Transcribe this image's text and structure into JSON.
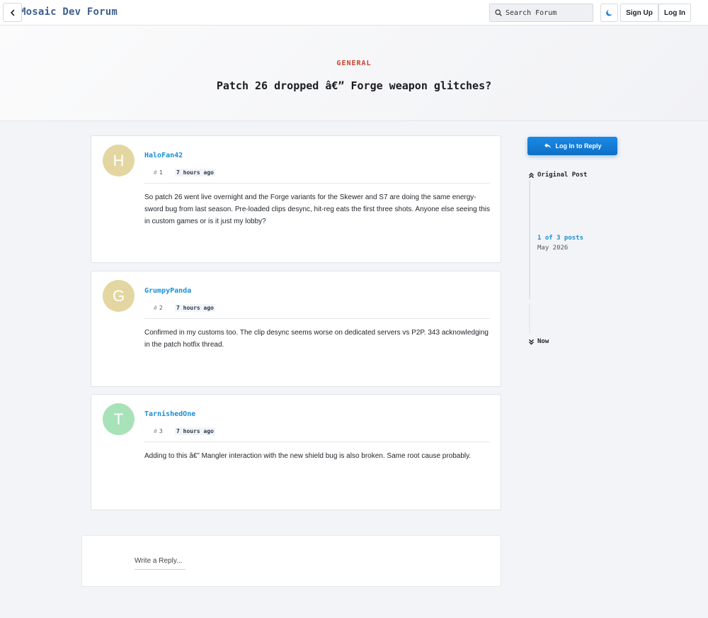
{
  "header": {
    "brand": "Mosaic Dev Forum",
    "search_placeholder": "Search Forum",
    "signup_label": "Sign Up",
    "login_label": "Log In"
  },
  "topic": {
    "category": "GENERAL",
    "title": "Patch 26 dropped â€” Forge weapon glitches?"
  },
  "posts": [
    {
      "initial": "H",
      "avatar_color": "#e3d6a0",
      "author": "HaloFan42",
      "number": "1",
      "time": "7 hours ago",
      "body": "So patch 26 went live overnight and the Forge variants for the Skewer and S7 are doing the same energy-sword bug from last season. Pre-loaded clips desync, hit-reg eats the first three shots. Anyone else seeing this in custom games or is it just my lobby?"
    },
    {
      "initial": "G",
      "avatar_color": "#e3d6a0",
      "author": "GrumpyPanda",
      "number": "2",
      "time": "7 hours ago",
      "body": "Confirmed in my customs too. The clip desync seems worse on dedicated servers vs P2P. 343 acknowledging in the patch hotfix thread."
    },
    {
      "initial": "T",
      "avatar_color": "#a8e2b8",
      "author": "TarnishedOne",
      "number": "3",
      "time": "7 hours ago",
      "body": "Adding to this â€” Mangler interaction with the new shield bug is also broken. Same root cause probably."
    }
  ],
  "reply": {
    "placeholder": "Write a Reply..."
  },
  "sidebar": {
    "reply_button": "Log In to Reply",
    "top_label": "Original Post",
    "count_label": "1 of 3 posts",
    "date_label": "May 2026",
    "bottom_label": "Now"
  },
  "colors": {
    "accent": "#1a8fd6",
    "category": "#c8432a",
    "button": "#0f6fc6"
  }
}
